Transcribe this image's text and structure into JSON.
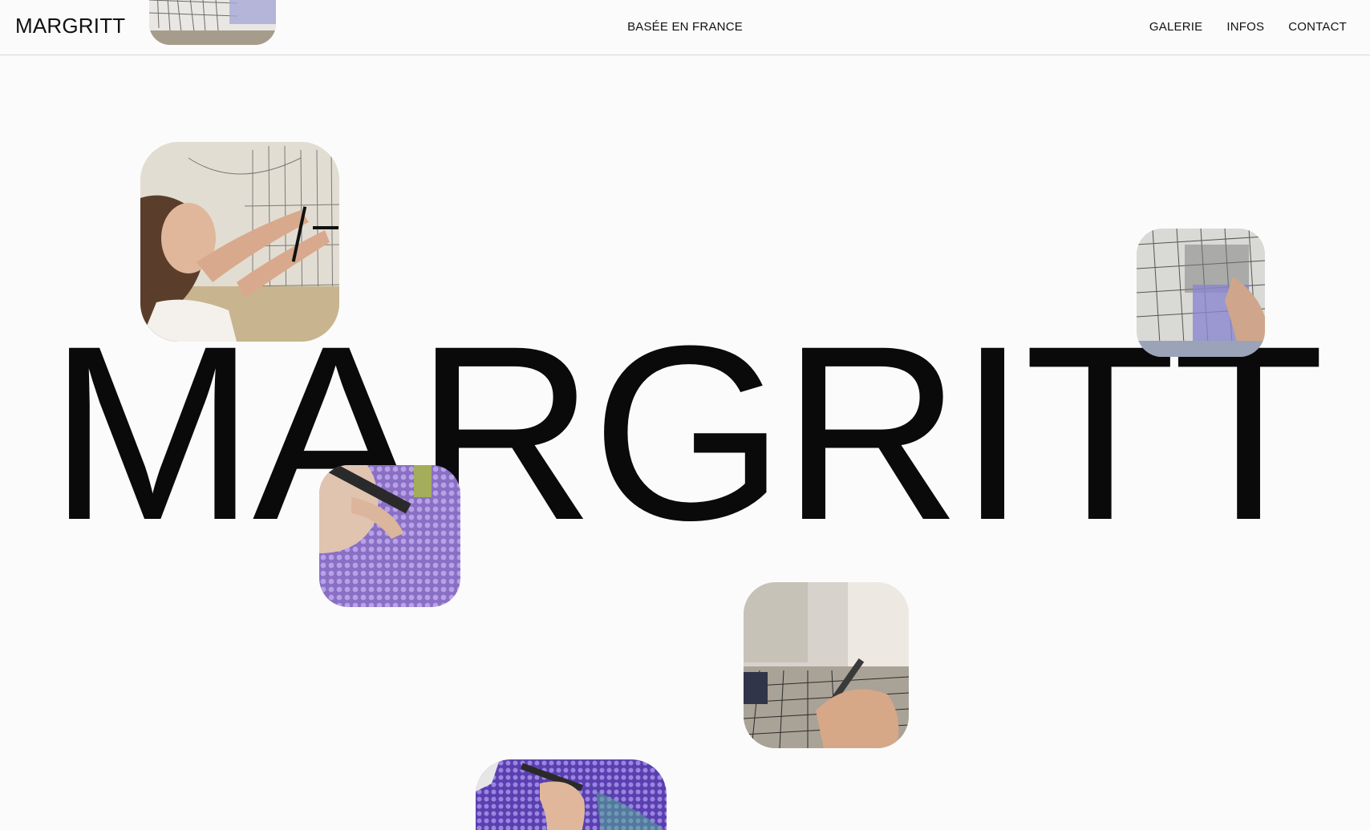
{
  "header": {
    "logo": "MARGRITT",
    "tagline": "BASÉE EN FRANCE",
    "nav": [
      {
        "label": "GALERIE"
      },
      {
        "label": "INFOS"
      },
      {
        "label": "CONTACT"
      }
    ]
  },
  "hero": {
    "wordmark": "MARGRITT"
  },
  "colors": {
    "background": "#fbfbfb",
    "text": "#0a0a0a",
    "divider": "#d9d9d9"
  }
}
